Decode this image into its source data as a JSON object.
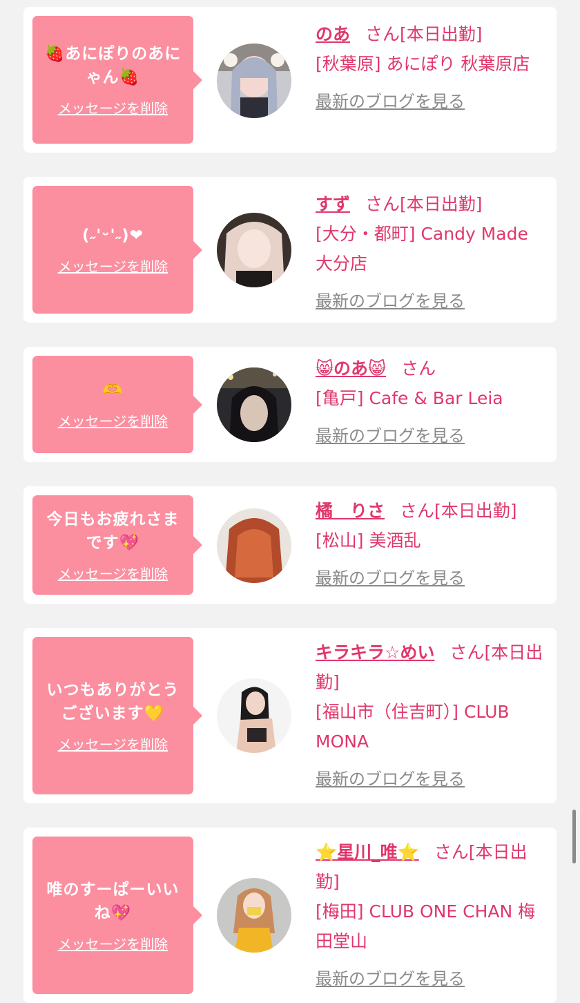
{
  "colors": {
    "accent": "#e0376b",
    "bubble": "#fb8fa0",
    "muted": "#8a8a8a",
    "background": "#f2f2f2"
  },
  "cards": [
    {
      "message": "🍓あにぽりのあにゃん🍓",
      "delete_label": "メッセージを削除",
      "name": "のあ",
      "honorific": "さん",
      "status": "[本日出勤]",
      "shop": "[秋葉原] あにぽり 秋葉原店",
      "blog_label": "最新のブログを見る",
      "avatar_icon": "profile-photo"
    },
    {
      "message": "(˶'ᵕ'˶)❤",
      "delete_label": "メッセージを削除",
      "name": "すず",
      "honorific": "さん",
      "status": "[本日出勤]",
      "shop": "[大分・都町] Candy Made 大分店",
      "blog_label": "最新のブログを見る",
      "avatar_icon": "profile-photo"
    },
    {
      "message": "🫶",
      "delete_label": "メッセージを削除",
      "name": "😸のあ😸",
      "honorific": "さん",
      "status": "",
      "shop": "[亀戸] Cafe & Bar Leia",
      "blog_label": "最新のブログを見る",
      "avatar_icon": "profile-photo"
    },
    {
      "message": "今日もお疲れさまです💖",
      "delete_label": "メッセージを削除",
      "name": "橘　りさ",
      "honorific": "さん",
      "status": "[本日出勤]",
      "shop": "[松山] 美酒乱",
      "blog_label": "最新のブログを見る",
      "avatar_icon": "profile-photo"
    },
    {
      "message": "いつもありがとうございます💛",
      "delete_label": "メッセージを削除",
      "name": "キラキラ☆めい",
      "honorific": "さん",
      "status": "[本日出勤]",
      "shop": "[福山市（住吉町）] CLUB MONA",
      "blog_label": "最新のブログを見る",
      "avatar_icon": "profile-photo"
    },
    {
      "message": "唯のすーぱーいいね💖",
      "delete_label": "メッセージを削除",
      "name": "⭐星川_唯⭐",
      "honorific": "さん",
      "status": "[本日出勤]",
      "shop": "[梅田] CLUB ONE CHAN 梅田堂山",
      "blog_label": "最新のブログを見る",
      "avatar_icon": "profile-photo"
    }
  ]
}
